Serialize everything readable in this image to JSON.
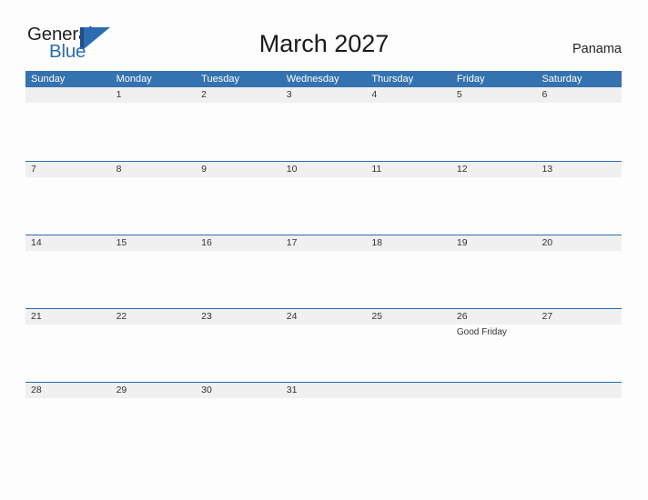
{
  "brand": {
    "name_part1": "General",
    "name_part2": "Blue",
    "mark_icon": "triangle-flag-icon",
    "accent_color": "#2a6db0"
  },
  "header": {
    "title": "March 2027",
    "location": "Panama"
  },
  "calendar": {
    "header_bg": "#3572b0",
    "band_bg": "#f0f0f0",
    "rule_color": "#2a6db0",
    "weekdays": [
      "Sunday",
      "Monday",
      "Tuesday",
      "Wednesday",
      "Thursday",
      "Friday",
      "Saturday"
    ],
    "weeks": [
      {
        "days": [
          {
            "num": "",
            "events": []
          },
          {
            "num": "1",
            "events": []
          },
          {
            "num": "2",
            "events": []
          },
          {
            "num": "3",
            "events": []
          },
          {
            "num": "4",
            "events": []
          },
          {
            "num": "5",
            "events": []
          },
          {
            "num": "6",
            "events": []
          }
        ]
      },
      {
        "days": [
          {
            "num": "7",
            "events": []
          },
          {
            "num": "8",
            "events": []
          },
          {
            "num": "9",
            "events": []
          },
          {
            "num": "10",
            "events": []
          },
          {
            "num": "11",
            "events": []
          },
          {
            "num": "12",
            "events": []
          },
          {
            "num": "13",
            "events": []
          }
        ]
      },
      {
        "days": [
          {
            "num": "14",
            "events": []
          },
          {
            "num": "15",
            "events": []
          },
          {
            "num": "16",
            "events": []
          },
          {
            "num": "17",
            "events": []
          },
          {
            "num": "18",
            "events": []
          },
          {
            "num": "19",
            "events": []
          },
          {
            "num": "20",
            "events": []
          }
        ]
      },
      {
        "days": [
          {
            "num": "21",
            "events": []
          },
          {
            "num": "22",
            "events": []
          },
          {
            "num": "23",
            "events": []
          },
          {
            "num": "24",
            "events": []
          },
          {
            "num": "25",
            "events": []
          },
          {
            "num": "26",
            "events": [
              "Good Friday"
            ]
          },
          {
            "num": "27",
            "events": []
          }
        ]
      },
      {
        "days": [
          {
            "num": "28",
            "events": []
          },
          {
            "num": "29",
            "events": []
          },
          {
            "num": "30",
            "events": []
          },
          {
            "num": "31",
            "events": []
          },
          {
            "num": "",
            "events": []
          },
          {
            "num": "",
            "events": []
          },
          {
            "num": "",
            "events": []
          }
        ]
      }
    ]
  }
}
